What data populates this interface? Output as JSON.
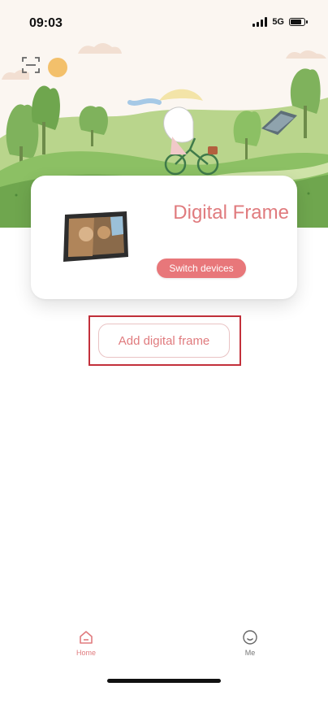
{
  "status_bar": {
    "time": "09:03",
    "network": "5G",
    "signal_bars": 4,
    "battery_level": 0.75
  },
  "header": {
    "scan_icon": "scan-icon"
  },
  "device_card": {
    "name": "Digital Frame",
    "switch_label": "Switch devices",
    "image": "digital-frame-photo"
  },
  "actions": {
    "add_frame_label": "Add digital frame"
  },
  "tab_bar": {
    "tabs": [
      {
        "label": "Home",
        "icon": "home-icon",
        "active": true
      },
      {
        "label": "Me",
        "icon": "smiley-icon",
        "active": false
      }
    ]
  },
  "colors": {
    "accent": "#e07b7e",
    "switch_button": "#e8777a",
    "highlight": "#c3303b"
  }
}
